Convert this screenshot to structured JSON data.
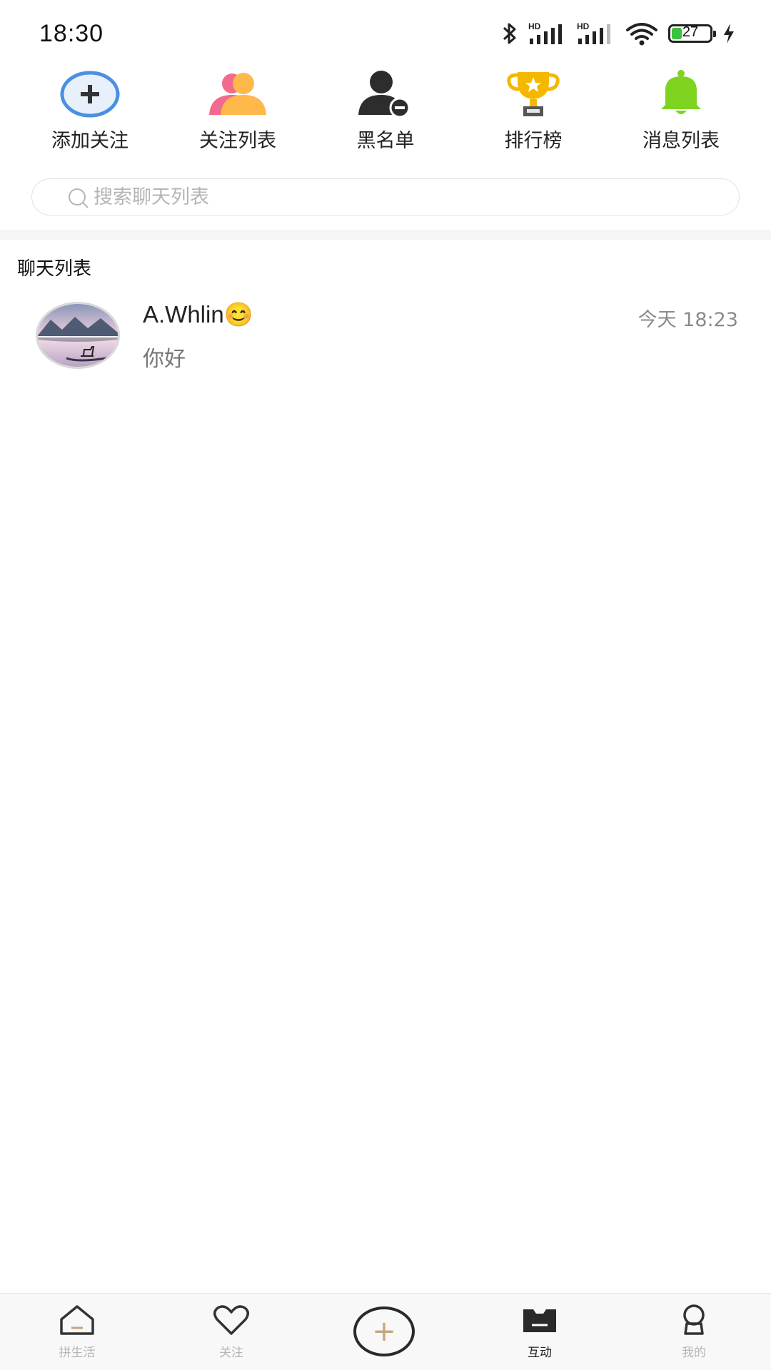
{
  "status_bar": {
    "time": "18:30",
    "battery_level": "27",
    "icons": [
      "bluetooth-icon",
      "signal-hd-icon",
      "signal-hd-icon",
      "wifi-icon",
      "battery-icon",
      "charging-icon"
    ]
  },
  "quick_actions": [
    {
      "label": "添加关注",
      "icon": "add-follow-icon"
    },
    {
      "label": "关注列表",
      "icon": "follow-list-icon"
    },
    {
      "label": "黑名单",
      "icon": "blacklist-icon"
    },
    {
      "label": "排行榜",
      "icon": "trophy-icon"
    },
    {
      "label": "消息列表",
      "icon": "bell-icon"
    }
  ],
  "search": {
    "placeholder": "搜索聊天列表"
  },
  "chat_section": {
    "title": "聊天列表",
    "items": [
      {
        "name": "A.Whlin😊",
        "time": "今天 18:23",
        "preview": "你好"
      }
    ]
  },
  "bottom_nav": {
    "items": [
      {
        "label": "拼生活",
        "icon": "home-icon",
        "active": false
      },
      {
        "label": "关注",
        "icon": "heart-icon",
        "active": false
      },
      {
        "label": "互动",
        "icon": "chat-box-icon",
        "active": true
      },
      {
        "label": "我的",
        "icon": "profile-icon",
        "active": false
      }
    ],
    "plus_glyph": "+"
  },
  "colors": {
    "accent_plus": "#c5a47e",
    "add_follow_blue": "#4a90e2",
    "follow_pink": "#f26a8d",
    "follow_orange": "#ffb84a",
    "trophy_gold": "#f5b800",
    "bell_green": "#7ed321",
    "battery_green": "#3cc23c"
  }
}
